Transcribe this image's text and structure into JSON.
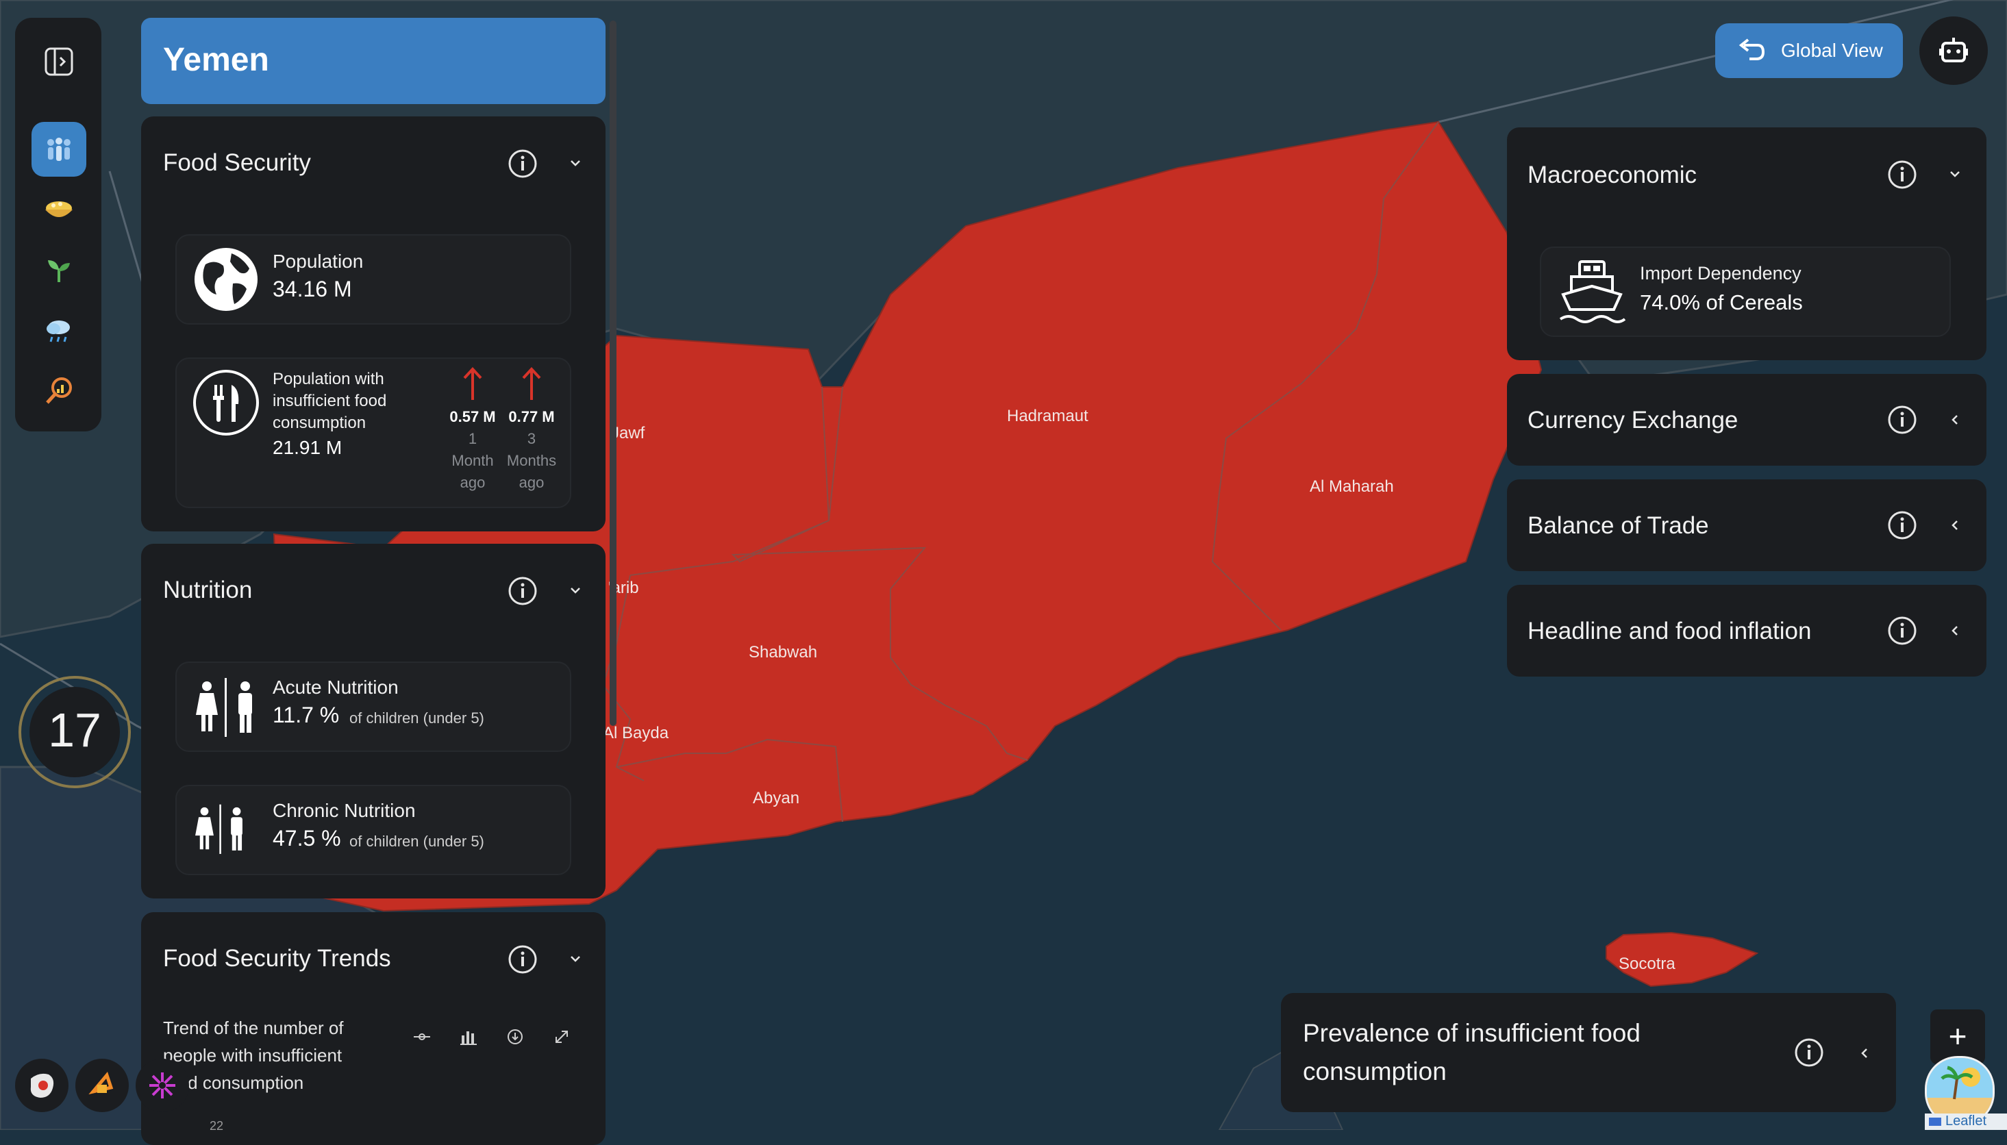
{
  "country": {
    "name": "Yemen"
  },
  "map": {
    "labels": [
      "Hadramaut",
      "Al Maharah",
      "Shabwah",
      "Abyan",
      "Socotra",
      "l Jawf",
      "'arib",
      "Al Bayda"
    ],
    "colors": {
      "sea": "#1c3241",
      "land": "#283a45",
      "region": "#c52e23",
      "border": "#3f4c55"
    },
    "attribution": "Leaflet"
  },
  "top_controls": {
    "global_view_label": "Global View",
    "global_view_icon": "undo-arrow-icon",
    "assistant_icon": "robot-icon"
  },
  "rail": {
    "toggle_icon": "sidebar-toggle-icon",
    "items": [
      "population-icon",
      "food-bowl-icon",
      "sprout-icon",
      "rain-cloud-icon",
      "analytics-search-icon"
    ]
  },
  "zoom_badge": {
    "value": "17"
  },
  "food_security": {
    "title": "Food Security",
    "population": {
      "label": "Population",
      "value": "34.16 M"
    },
    "insufficient": {
      "label_lines": [
        "Population with",
        "insufficient food",
        "consumption"
      ],
      "value": "21.91 M",
      "change_1": {
        "value": "0.57 M",
        "period_lines": [
          "1",
          "Month",
          "ago"
        ]
      },
      "change_3": {
        "value": "0.77 M",
        "period_lines": [
          "3",
          "Months",
          "ago"
        ]
      }
    }
  },
  "nutrition": {
    "title": "Nutrition",
    "acute": {
      "label": "Acute Nutrition",
      "value": "11.7 %",
      "suffix": "of children (under 5)"
    },
    "chronic": {
      "label": "Chronic Nutrition",
      "value": "47.5 %",
      "suffix": "of children (under 5)"
    }
  },
  "trends": {
    "title": "Food Security Trends",
    "desc_lines": [
      "Trend of the number of",
      "people with insufficient",
      "food consumption"
    ],
    "tools": [
      "line-chart-icon",
      "bar-chart-icon",
      "download-icon",
      "expand-icon"
    ],
    "axis_partial": "22"
  },
  "macro": {
    "title": "Macroeconomic",
    "import": {
      "label": "Import Dependency",
      "value": "74.0% of Cereals"
    }
  },
  "collapsed_panels": [
    "Currency Exchange",
    "Balance of Trade",
    "Headline and food inflation"
  ],
  "prevalence": {
    "title_lines": [
      "Prevalence of insufficient food",
      "consumption"
    ]
  },
  "bottom_left_icons": [
    "map-layer-icon",
    "ipc-logo-icon",
    "partner-logo-icon"
  ],
  "zoom_control": {
    "plus": "+"
  },
  "accent": "#3b7ec1"
}
